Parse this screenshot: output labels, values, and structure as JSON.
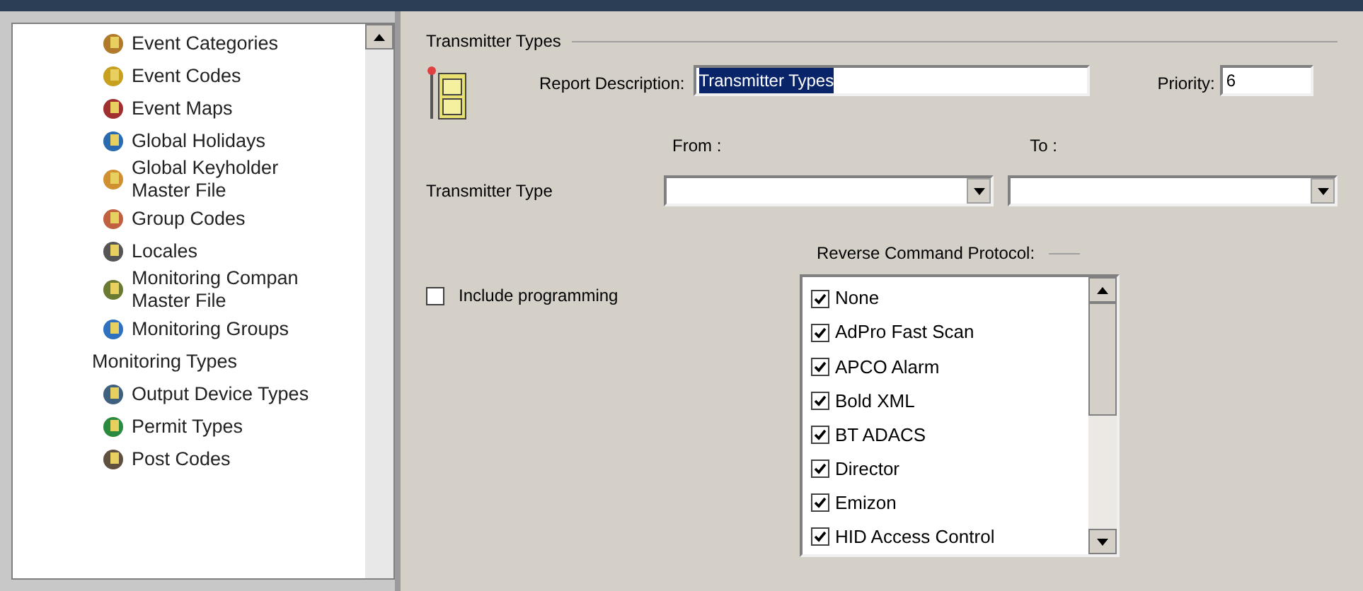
{
  "tree": {
    "items": [
      {
        "label": "Event Categories",
        "kind": "icon"
      },
      {
        "label": "Event Codes",
        "kind": "icon"
      },
      {
        "label": "Event Maps",
        "kind": "icon"
      },
      {
        "label": "Global Holidays",
        "kind": "icon"
      },
      {
        "label": "Global Keyholder Master File",
        "kind": "icon"
      },
      {
        "label": "Group Codes",
        "kind": "icon"
      },
      {
        "label": "Locales",
        "kind": "icon"
      },
      {
        "label": "Monitoring Compan Master File",
        "kind": "icon"
      },
      {
        "label": "Monitoring Groups",
        "kind": "icon"
      },
      {
        "label": "Monitoring Types",
        "kind": "plain"
      },
      {
        "label": "Output Device Types",
        "kind": "icon"
      },
      {
        "label": "Permit Types",
        "kind": "icon"
      },
      {
        "label": "Post Codes",
        "kind": "icon"
      }
    ]
  },
  "form": {
    "group_title": "Transmitter Types",
    "report_description": {
      "label": "Report Description:",
      "value": "Transmitter Types"
    },
    "priority": {
      "label": "Priority:",
      "value": "6"
    },
    "from_label": "From :",
    "to_label": "To :",
    "transmitter_type_label": "Transmitter Type",
    "include_programming": {
      "label": "Include programming",
      "checked": false
    },
    "protocol_title": "Reverse Command Protocol:",
    "protocols": [
      {
        "label": "None",
        "checked": true
      },
      {
        "label": "AdPro Fast Scan",
        "checked": true
      },
      {
        "label": "APCO Alarm",
        "checked": true
      },
      {
        "label": "Bold XML",
        "checked": true
      },
      {
        "label": "BT ADACS",
        "checked": true
      },
      {
        "label": "Director",
        "checked": true
      },
      {
        "label": "Emizon",
        "checked": true
      },
      {
        "label": "HID Access Control",
        "checked": true
      }
    ]
  }
}
